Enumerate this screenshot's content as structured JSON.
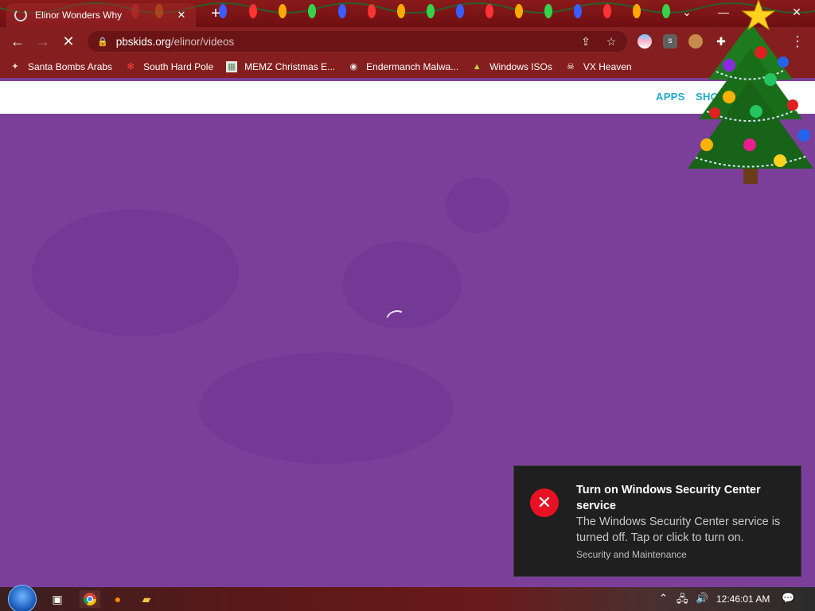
{
  "tab": {
    "title": "Elinor Wonders Why"
  },
  "toolbar": {
    "url_host": "pbskids.org",
    "url_path": "/elinor/videos"
  },
  "bookmarks": [
    {
      "label": "Santa Bombs Arabs",
      "icon": "santa-icon"
    },
    {
      "label": "South Hard Pole",
      "icon": "snowflake-icon"
    },
    {
      "label": "MEMZ Christmas E...",
      "icon": "image-icon"
    },
    {
      "label": "Endermanch Malwa...",
      "icon": "raccoon-icon"
    },
    {
      "label": "Windows ISOs",
      "icon": "tree-icon"
    },
    {
      "label": "VX Heaven",
      "icon": "skull-icon"
    }
  ],
  "site": {
    "nav_apps": "APPS",
    "nav_shop": "SHO"
  },
  "toast": {
    "title": "Turn on Windows Security Center service",
    "body": "The Windows Security Center service is turned off. Tap or click to turn on.",
    "source": "Security and Maintenance"
  },
  "taskbar": {
    "clock": "12:46:01 AM"
  },
  "colors": {
    "page_bg": "#7b3f9a",
    "chrome_bg": "#851f1f",
    "nav_accent": "#1eaad0",
    "toast_error": "#e81123"
  }
}
